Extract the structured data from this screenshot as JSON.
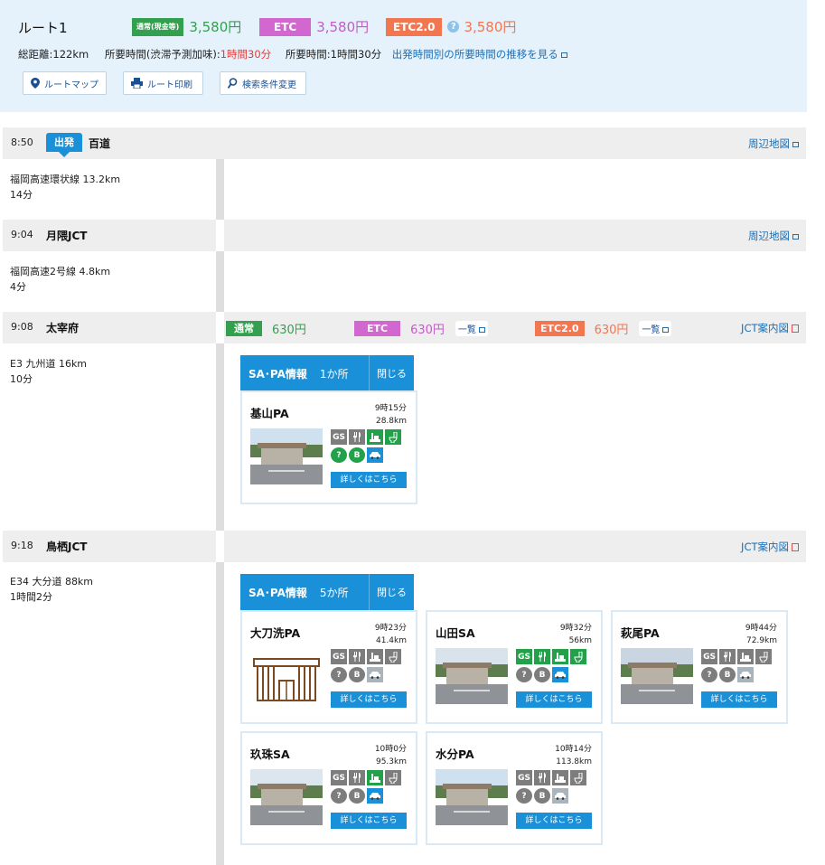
{
  "route": {
    "title": "ルート1",
    "fares": [
      {
        "tag": "通常(現金等)",
        "amount": "3,580円",
        "tag_color": "#33a04f",
        "amount_color": "#33a04f"
      },
      {
        "tag": "ETC",
        "amount": "3,580円",
        "tag_color": "#d267cf",
        "amount_color": "#c45bc8"
      },
      {
        "tag": "ETC2.0",
        "amount": "3,580円",
        "tag_color": "#f2764f",
        "amount_color": "#f2764f"
      }
    ],
    "distance": "総距離:122km",
    "time_traffic_label": "所要時間(渋滞予測加味):",
    "time_traffic_value": "1時間30分",
    "time_label": "所要時間:1時間30分",
    "trend_link": "出発時間別の所要時間の推移を見る",
    "buttons": {
      "map": "ルートマップ",
      "print": "ルート印刷",
      "change": "検索条件変更"
    }
  },
  "stations": [
    {
      "time": "8:50",
      "badge": "出発",
      "name": "百道",
      "link": "周辺地図"
    },
    {
      "time": "9:04",
      "name": "月隈JCT",
      "link": "周辺地図"
    },
    {
      "time": "9:08",
      "name": "太宰府",
      "link": "JCT案内図"
    },
    {
      "time": "9:18",
      "name": "鳥栖JCT",
      "link": "JCT案内図"
    }
  ],
  "segments": [
    {
      "road": "福岡高速環状線 13.2km",
      "duration": "14分"
    },
    {
      "road": "福岡高速2号線 4.8km",
      "duration": "4分"
    },
    {
      "road": "E3 九州道 16km",
      "duration": "10分"
    },
    {
      "road": "E34 大分道 88km",
      "duration": "1時間2分"
    }
  ],
  "dazaifu_fares": [
    {
      "tag": "通常",
      "amount": "630円",
      "tag_color": "#33a04f",
      "amount_color": "#33a04f"
    },
    {
      "tag": "ETC",
      "amount": "630円",
      "tag_color": "#d267cf",
      "amount_color": "#c45bc8",
      "list": "一覧"
    },
    {
      "tag": "ETC2.0",
      "amount": "630円",
      "tag_color": "#f2764f",
      "amount_color": "#f2764f",
      "list": "一覧"
    }
  ],
  "sapa_groups": [
    {
      "title": "SA･PA情報",
      "count": "1か所",
      "close": "閉じる",
      "cards": [
        {
          "name": "基山PA",
          "time": "9時15分",
          "dist": "28.8km",
          "detail": "詳しくはこちら",
          "thumb": "photo"
        }
      ]
    },
    {
      "title": "SA･PA情報",
      "count": "5か所",
      "close": "閉じる",
      "cards": [
        {
          "name": "大刀洗PA",
          "time": "9時23分",
          "dist": "41.4km",
          "detail": "詳しくはこちら",
          "thumb": "building-icon"
        },
        {
          "name": "山田SA",
          "time": "9時32分",
          "dist": "56km",
          "detail": "詳しくはこちら",
          "thumb": "photo"
        },
        {
          "name": "萩尾PA",
          "time": "9時44分",
          "dist": "72.9km",
          "detail": "詳しくはこちら",
          "thumb": "photo"
        },
        {
          "name": "玖珠SA",
          "time": "10時0分",
          "dist": "95.3km",
          "detail": "詳しくはこちら",
          "thumb": "photo"
        },
        {
          "name": "水分PA",
          "time": "10時14分",
          "dist": "113.8km",
          "detail": "詳しくはこちら",
          "thumb": "photo"
        }
      ]
    }
  ],
  "facility_icons": {
    "gs": "GS",
    "info": "?",
    "baby": "B"
  }
}
